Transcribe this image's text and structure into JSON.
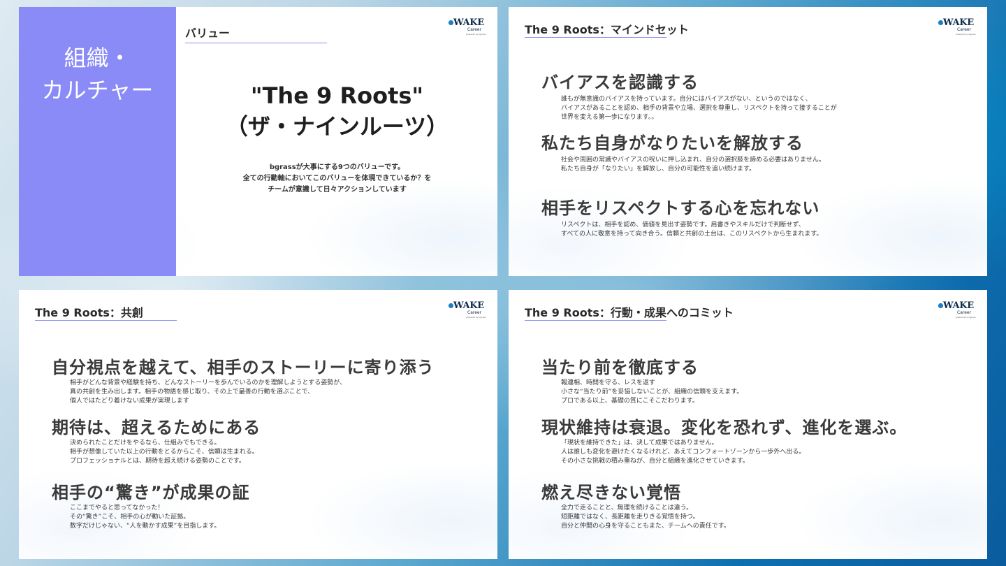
{
  "logo": {
    "main": "WAKE",
    "sub": "Career",
    "fine": "powered by bgrass"
  },
  "slide1": {
    "side_title_line1": "組織・",
    "side_title_line2": "カルチャー",
    "header": "バリュー",
    "big_title_line1": "\"The 9 Roots\"",
    "big_title_line2": "（ザ・ナインルーツ）",
    "intro": [
      "bgrassが大事にする9つのバリューです。",
      "全ての行動軸においてこのバリューを体現できているか？を",
      "チームが意識して日々アクションしています"
    ]
  },
  "slide2": {
    "header": "The 9 Roots：マインドセット",
    "values": [
      {
        "heading": "バイアスを認識する",
        "desc": [
          "誰もが無意識のバイアスを持っています。自分にはバイアスがない、というのではなく、",
          "バイアスがあることを認め、相手の背景や立場、選択を尊重し、リスペクトを持って接することが",
          "世界を変える第一歩になります。。"
        ]
      },
      {
        "heading": "私たち自身がなりたいを解放する",
        "desc": [
          "社会や周囲の常識やバイアスの呪いに押し込まれ、自分の選択肢を諦める必要はありません。",
          "私たち自身が「なりたい」を解放し、自分の可能性を追い続けます。"
        ]
      },
      {
        "heading": "相手をリスペクトする心を忘れない",
        "desc": [
          "リスペクトは、相手を認め、価値を見出す姿勢です。肩書きやスキルだけで判断せず、",
          "すべての人に敬意を持って向き合う。信頼と共創の土台は、このリスペクトから生まれます。"
        ]
      }
    ]
  },
  "slide3": {
    "header": "The 9 Roots：共創",
    "values": [
      {
        "heading": "自分視点を越えて、相手のストーリーに寄り添う",
        "desc": [
          "相手がどんな背景や経験を持ち、どんなストーリーを歩んでいるのかを理解しようとする姿勢が、",
          "真の共創を生み出します。相手の物語を感じ取り、その上で最善の行動を選ぶことで、",
          "個人ではたどり着けない成果が実現します"
        ]
      },
      {
        "heading": "期待は、超えるためにある",
        "desc": [
          "決められたことだけをやるなら、仕組みでもできる。",
          "相手が想像していた以上の行動をとるからこそ、信頼は生まれる。",
          "プロフェッショナルとは、期待を超え続ける姿勢のことです。"
        ]
      },
      {
        "heading": "相手の“驚き”が成果の証",
        "desc": [
          "ここまでやると思ってなかった！",
          "その“驚き”こそ、相手の心が動いた証拠。",
          "数字だけじゃない、“人を動かす成果”を目指します。"
        ]
      }
    ]
  },
  "slide4": {
    "header": "The 9 Roots：行動・成果へのコミット",
    "values": [
      {
        "heading": "当たり前を徹底する",
        "desc": [
          "報連相、時間を守る、レスを返す",
          "小さな“当たり前”を妥協しないことが、組織の信頼を支えます。",
          "プロである以上、基礎の質にこそこだわります。"
        ]
      },
      {
        "heading": "現状維持は衰退。変化を恐れず、進化を選ぶ。",
        "desc": [
          "「現状を維持できた」は、決して成果ではありません。",
          "人は誰しも変化を避けたくなるけれど、あえてコンフォートゾーンから一歩外へ出る。",
          "その小さな挑戦の積み重ねが、自分と組織を進化させていきます。"
        ]
      },
      {
        "heading": "燃え尽きない覚悟",
        "desc": [
          "全力で走ることと、無理を続けることは違う。",
          "短距離ではなく、長距離を走りきる覚悟を持つ。",
          "自分と仲間の心身を守ることもまた、チームへの責任です。"
        ]
      }
    ]
  },
  "colors": {
    "accent": "#8a8bf7",
    "logo": "#0b2a4a"
  }
}
